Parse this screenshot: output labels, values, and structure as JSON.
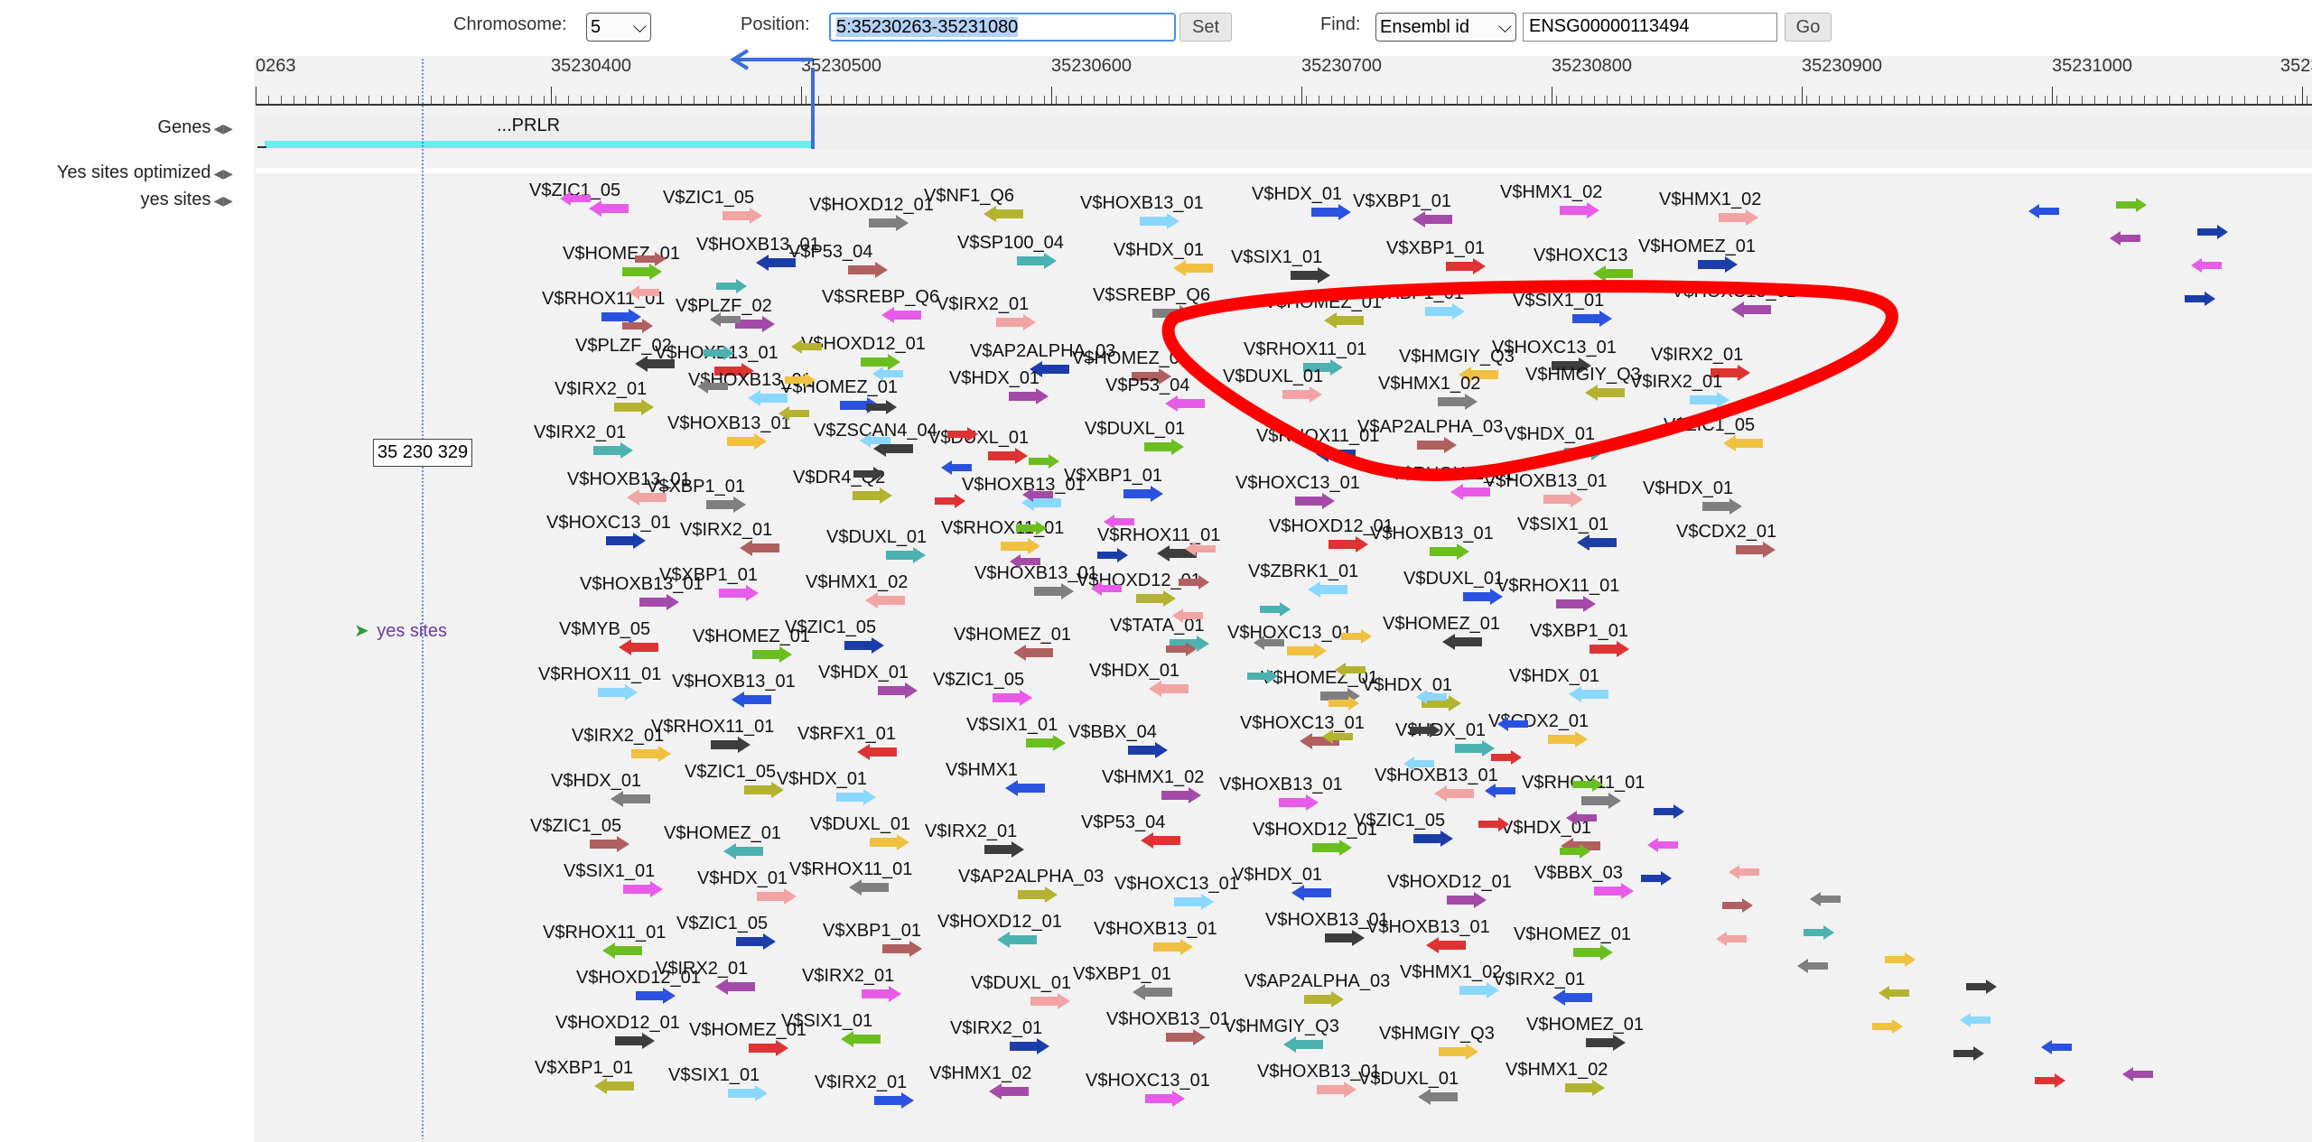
{
  "toolbar": {
    "chromosome_label": "Chromosome:",
    "chromosome_value": "5",
    "position_label": "Position:",
    "position_value": "5:35230263-35231080",
    "set_label": "Set",
    "find_label": "Find:",
    "find_type": "Ensembl id",
    "find_value": "ENSG00000113494",
    "go_label": "Go"
  },
  "tracks": {
    "genes": "Genes",
    "yes_optimized": "Yes sites optimized",
    "yes_sites": "yes sites"
  },
  "ruler": {
    "ticks": [
      "0263",
      "35230400",
      "35230500",
      "35230600",
      "35230700",
      "35230800",
      "35230900",
      "35231000",
      "3523"
    ]
  },
  "gene": {
    "label": "...PRLR",
    "color": "#66eef0"
  },
  "cursor": {
    "coordinate_label": "35 230 329"
  },
  "legend": {
    "label": "yes sites",
    "color": "#6a3d9a"
  },
  "annotation_color": "#ff0000",
  "marker_color": "#3a6fd8",
  "site_names": [
    "V$ZIC1_05",
    "V$HOMEZ_01",
    "V$RHOX11_01",
    "V$PLZF_02",
    "V$IRX2_01",
    "V$IRX2_01",
    "V$HOXB13_01",
    "V$HOXC13_01",
    "V$HOXB13_01",
    "V$MYB_05",
    "V$RHOX11_01",
    "V$IRX2_01",
    "V$HDX_01",
    "V$ZIC1_05",
    "V$SIX1_01",
    "V$RHOX11_01",
    "V$HOXD12_01",
    "V$HOXD12_01",
    "V$XBP1_01",
    "V$RHOX11_01",
    "V$ZIC1_05",
    "V$HOXB13_01",
    "V$PLZF_02",
    "V$HOXB13_01",
    "V$HOXB13_01",
    "V$HOXB13_01",
    "V$XBP1_01",
    "V$IRX2_01",
    "V$XBP1_01",
    "V$HOMEZ_01",
    "V$HOXB13_01",
    "V$RHOX11_01",
    "V$ZIC1_05",
    "V$HOMEZ_01",
    "V$HDX_01",
    "V$ZIC1_05",
    "V$IRX2_01",
    "V$HOMEZ_01",
    "V$SIX1_01",
    "V$IRX2_01",
    "V$HOXD12_01",
    "V$P53_04",
    "V$SREBP_Q6",
    "V$HOXD12_01",
    "V$HOMEZ_01",
    "V$ZSCAN4_04",
    "V$DR4_Q2",
    "V$DUXL_01",
    "V$HMX1_02",
    "V$ZIC1_05",
    "V$HDX_01",
    "V$RFX1_01",
    "V$HDX_01",
    "V$DUXL_01",
    "V$RHOX11_01",
    "V$XBP1_01",
    "V$IRX2_01",
    "V$SIX1_01",
    "V$IRX2_01",
    "V$HOMEZ_01",
    "V$NF1_Q6",
    "V$SP100_04",
    "V$IRX2_01",
    "V$AP2ALPHA_03",
    "V$HDX_01",
    "V$DUXL_01",
    "V$HOXB13_01",
    "V$RHOX11_01",
    "V$HOXB13_01",
    "V$HOMEZ_01",
    "V$ZIC1_05",
    "V$SIX1_01",
    "V$HMX1",
    "V$IRX2_01",
    "V$AP2ALPHA_03",
    "V$HOXD12_01",
    "V$DUXL_01",
    "V$IRX2_01",
    "V$HMX1_02",
    "V$SIX1_01",
    "V$HOXB13_01",
    "V$HDX_01",
    "V$SREBP_Q6",
    "V$HOMEZ_01",
    "V$P53_04",
    "V$DUXL_01",
    "V$XBP1_01",
    "V$RHOX11_01",
    "V$HOXD12_01",
    "V$TATA_01",
    "V$HDX_01",
    "V$BBX_04",
    "V$HMX1_02",
    "V$P53_04",
    "V$HOXC13_01",
    "V$HOXB13_01",
    "V$XBP1_01",
    "V$HOXB13_01",
    "V$HOXC13_01",
    "V$MUSCLEINI_B",
    "V$HDX_01",
    "V$SIX1_01",
    "V$HOMEZ_01",
    "V$RHOX11_01",
    "V$DUXL_01",
    "V$RHOX11_01",
    "V$HOXC13_01",
    "V$HOXD12_01",
    "V$ZBRK1_01",
    "V$HOXC13_01",
    "V$HOMEZ_01",
    "V$HOXC13_01",
    "V$HOXB13_01",
    "V$HOXD12_01",
    "V$HDX_01",
    "V$HOXB13_01",
    "V$AP2ALPHA_03",
    "V$HMGIY_Q3",
    "V$HOXB13_01",
    "V$TATA_01",
    "V$XBP1_01",
    "V$XBP1_01",
    "V$XBP1_01",
    "V$HMGIY_Q3",
    "V$HMX1_02",
    "V$AP2ALPHA_03",
    "V$RHOX11_01",
    "V$HOXB13_01",
    "V$DUXL_01",
    "V$HOMEZ_01",
    "V$HDX_01",
    "V$HDX_01",
    "V$HOXB13_01",
    "V$ZIC1_05",
    "V$HOXD12_01",
    "V$HOXB13_01",
    "V$HMX1_02",
    "V$HMGIY_Q3",
    "V$DUXL_01",
    "V$SIX1_01",
    "V$HMX1_02",
    "V$HOXC13",
    "V$SIX1_01",
    "V$HOXC13_01",
    "V$HMGIY_Q3",
    "V$HDX_01",
    "V$HOXB13_01",
    "V$SIX1_01",
    "V$RHOX11_01",
    "V$XBP1_01",
    "V$HDX_01",
    "V$CDX2_01",
    "V$RHOX11_01",
    "V$HDX_01",
    "V$BBX_03",
    "V$HOMEZ_01",
    "V$IRX2_01",
    "V$HOMEZ_01",
    "V$HMX1_02",
    "V$HOXB13_01",
    "V$HMX1_02",
    "V$HOMEZ_01",
    "V$HOXC13_01",
    "V$IRX2_01",
    "V$IRX2_01",
    "V$ZIC1_05",
    "V$HDX_01",
    "V$CDX2_01"
  ]
}
